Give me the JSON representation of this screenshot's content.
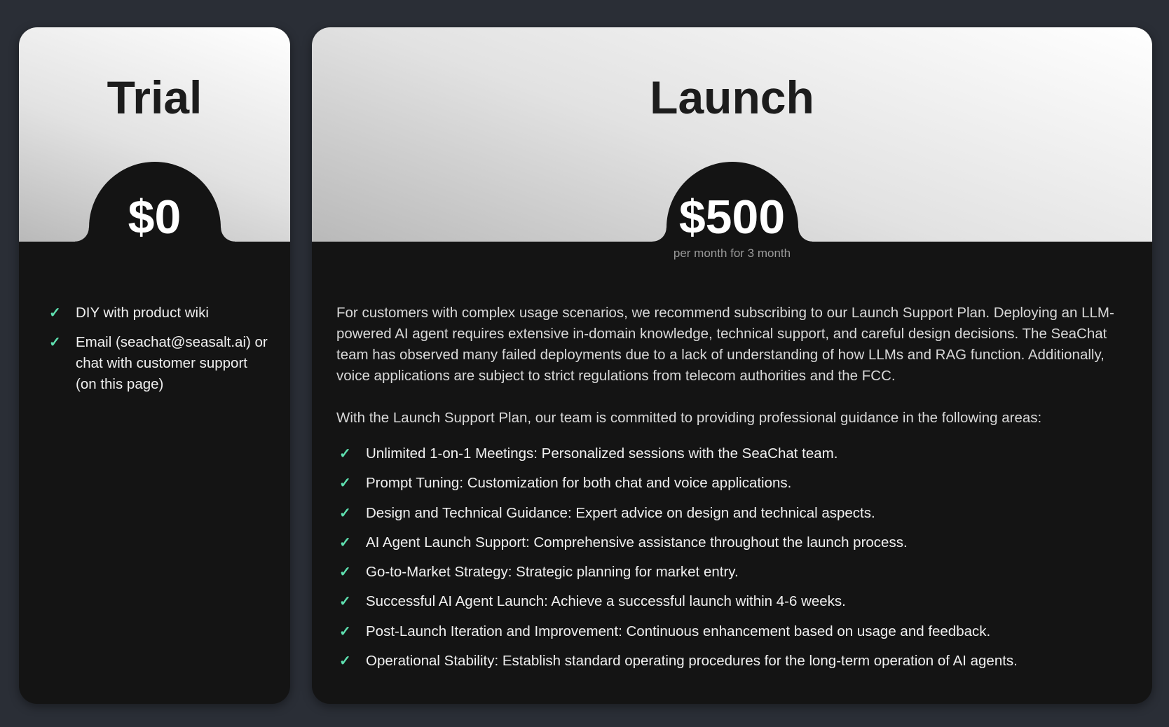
{
  "trial": {
    "title": "Trial",
    "price": "$0",
    "features": [
      "DIY with product wiki",
      "Email (seachat@seasalt.ai) or chat with customer support (on this page)"
    ]
  },
  "launch": {
    "title": "Launch",
    "price": "$500",
    "price_note": "per month for 3 month",
    "description": "For customers with complex usage scenarios, we recommend subscribing to our Launch Support Plan. Deploying an LLM-powered AI agent requires extensive in-domain knowledge, technical support, and careful design decisions. The SeaChat team has observed many failed deployments due to a lack of understanding of how LLMs and RAG function. Additionally, voice applications are subject to strict regulations from telecom authorities and the FCC.",
    "intro": "With the Launch Support Plan, our team is committed to providing professional guidance in the following areas:",
    "features": [
      "Unlimited 1-on-1 Meetings: Personalized sessions with the SeaChat team.",
      "Prompt Tuning: Customization for both chat and voice applications.",
      "Design and Technical Guidance: Expert advice on design and technical aspects.",
      "AI Agent Launch Support: Comprehensive assistance throughout the launch process.",
      "Go-to-Market Strategy: Strategic planning for market entry.",
      "Successful AI Agent Launch: Achieve a successful launch within 4-6 weeks.",
      "Post-Launch Iteration and Improvement: Continuous enhancement based on usage and feedback.",
      "Operational Stability: Establish standard operating procedures for the long-term operation of AI agents."
    ]
  },
  "icons": {
    "check": "check-icon"
  },
  "colors": {
    "check": "#5fe0b0",
    "background": "#2a2e36",
    "card": "#141414"
  }
}
